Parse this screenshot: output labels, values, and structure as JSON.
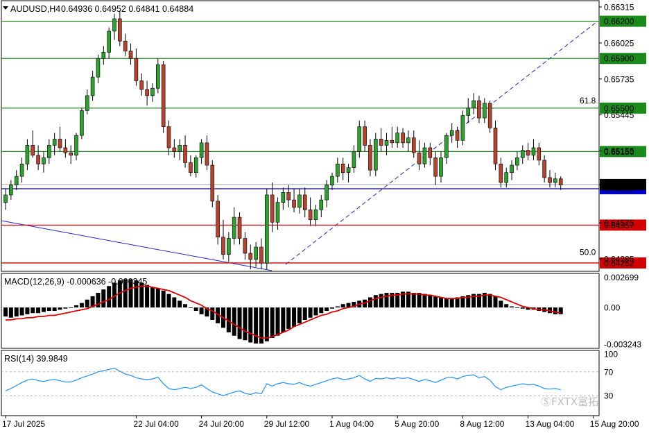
{
  "chart_data": {
    "type": "candlestick",
    "symbol_label": "AUDUSD,H4",
    "ohlc_label": "0.64936 0.64952 0.64841 0.64884",
    "price_axis": {
      "range": [
        0.6419,
        0.6636
      ],
      "ticks": [
        "0.66315",
        "0.66025",
        "0.65735",
        "0.65445",
        "0.65155",
        "0.64884",
        "0.64575",
        "0.64285"
      ]
    },
    "levels": [
      {
        "value": 0.662,
        "label": "0.66200",
        "color": "#1a8a1a",
        "style": "solid"
      },
      {
        "value": 0.659,
        "label": "0.65900",
        "color": "#1a8a1a",
        "style": "solid"
      },
      {
        "value": 0.655,
        "label": "0.65500",
        "color": "#1a8a1a",
        "style": "solid"
      },
      {
        "value": 0.6515,
        "label": "0.65150",
        "color": "#1a8a1a",
        "style": "solid"
      },
      {
        "value": 0.6485,
        "label": "0.64850",
        "color": "#0000cc",
        "style": "solid"
      },
      {
        "value": 0.64557,
        "label": "0.64557",
        "color": "#d40000",
        "style": "solid"
      },
      {
        "value": 0.64252,
        "label": "0.64252",
        "color": "#d40000",
        "style": "solid"
      }
    ],
    "current_price": {
      "value": 0.64884,
      "label": "0.64884"
    },
    "fib_labels": [
      {
        "text": "61.8",
        "value": 0.6552
      },
      {
        "text": "50.0",
        "value": 0.643
      }
    ],
    "candles": [
      [
        0.6474,
        0.6485,
        0.6468,
        0.648
      ],
      [
        0.648,
        0.6492,
        0.6476,
        0.6488
      ],
      [
        0.6488,
        0.65,
        0.6484,
        0.6495
      ],
      [
        0.6495,
        0.651,
        0.649,
        0.6505
      ],
      [
        0.6505,
        0.6525,
        0.65,
        0.652
      ],
      [
        0.652,
        0.6532,
        0.651,
        0.6512
      ],
      [
        0.6512,
        0.652,
        0.65,
        0.6505
      ],
      [
        0.6505,
        0.6515,
        0.6498,
        0.651
      ],
      [
        0.651,
        0.6525,
        0.6505,
        0.652
      ],
      [
        0.652,
        0.653,
        0.6512,
        0.6525
      ],
      [
        0.6525,
        0.6535,
        0.6515,
        0.6518
      ],
      [
        0.6518,
        0.6525,
        0.651,
        0.6514
      ],
      [
        0.6514,
        0.652,
        0.6505,
        0.6512
      ],
      [
        0.6512,
        0.653,
        0.6508,
        0.6528
      ],
      [
        0.6528,
        0.655,
        0.6525,
        0.6548
      ],
      [
        0.6548,
        0.6565,
        0.6545,
        0.656
      ],
      [
        0.656,
        0.658,
        0.6556,
        0.6575
      ],
      [
        0.6575,
        0.6593,
        0.657,
        0.659
      ],
      [
        0.659,
        0.66,
        0.6585,
        0.6595
      ],
      [
        0.6595,
        0.6615,
        0.659,
        0.6612
      ],
      [
        0.6612,
        0.6626,
        0.6605,
        0.6622
      ],
      [
        0.6622,
        0.6628,
        0.66,
        0.6604
      ],
      [
        0.6604,
        0.661,
        0.6592,
        0.6596
      ],
      [
        0.6596,
        0.6602,
        0.6585,
        0.659
      ],
      [
        0.659,
        0.6598,
        0.6568,
        0.6572
      ],
      [
        0.6572,
        0.6578,
        0.656,
        0.6565
      ],
      [
        0.6565,
        0.6572,
        0.6552,
        0.656
      ],
      [
        0.656,
        0.657,
        0.6555,
        0.6566
      ],
      [
        0.6566,
        0.659,
        0.6562,
        0.6585
      ],
      [
        0.6585,
        0.6588,
        0.653,
        0.6535
      ],
      [
        0.6535,
        0.654,
        0.6512,
        0.6518
      ],
      [
        0.6518,
        0.6525,
        0.651,
        0.6515
      ],
      [
        0.6515,
        0.6525,
        0.6508,
        0.652
      ],
      [
        0.652,
        0.6528,
        0.6502,
        0.6506
      ],
      [
        0.6506,
        0.6512,
        0.6495,
        0.6498
      ],
      [
        0.6498,
        0.6512,
        0.6494,
        0.651
      ],
      [
        0.651,
        0.6525,
        0.6505,
        0.6522
      ],
      [
        0.6522,
        0.6528,
        0.65,
        0.6504
      ],
      [
        0.6504,
        0.6508,
        0.647,
        0.6475
      ],
      [
        0.6475,
        0.648,
        0.644,
        0.6446
      ],
      [
        0.6446,
        0.646,
        0.6428,
        0.6432
      ],
      [
        0.6432,
        0.645,
        0.6426,
        0.6445
      ],
      [
        0.6445,
        0.647,
        0.644,
        0.6462
      ],
      [
        0.6462,
        0.6466,
        0.644,
        0.6445
      ],
      [
        0.6445,
        0.645,
        0.6428,
        0.6433
      ],
      [
        0.6433,
        0.644,
        0.642,
        0.6428
      ],
      [
        0.6428,
        0.6442,
        0.6422,
        0.6438
      ],
      [
        0.6438,
        0.6445,
        0.642,
        0.6425
      ],
      [
        0.6425,
        0.6485,
        0.642,
        0.648
      ],
      [
        0.648,
        0.649,
        0.645,
        0.6458
      ],
      [
        0.6458,
        0.6478,
        0.6452,
        0.6474
      ],
      [
        0.6474,
        0.6486,
        0.6468,
        0.6482
      ],
      [
        0.6482,
        0.6488,
        0.647,
        0.6476
      ],
      [
        0.6476,
        0.6485,
        0.6466,
        0.647
      ],
      [
        0.647,
        0.6485,
        0.6465,
        0.648
      ],
      [
        0.648,
        0.6486,
        0.6462,
        0.6468
      ],
      [
        0.6468,
        0.6478,
        0.6455,
        0.646
      ],
      [
        0.646,
        0.6472,
        0.6455,
        0.6468
      ],
      [
        0.6468,
        0.648,
        0.6462,
        0.6476
      ],
      [
        0.6476,
        0.6492,
        0.647,
        0.6488
      ],
      [
        0.6488,
        0.6498,
        0.6484,
        0.6495
      ],
      [
        0.6495,
        0.651,
        0.649,
        0.6505
      ],
      [
        0.6505,
        0.651,
        0.6492,
        0.6498
      ],
      [
        0.6498,
        0.6505,
        0.649,
        0.6502
      ],
      [
        0.6502,
        0.652,
        0.6498,
        0.6515
      ],
      [
        0.6515,
        0.654,
        0.651,
        0.6535
      ],
      [
        0.6535,
        0.654,
        0.6515,
        0.652
      ],
      [
        0.652,
        0.6525,
        0.6495,
        0.65
      ],
      [
        0.65,
        0.653,
        0.6495,
        0.6525
      ],
      [
        0.6525,
        0.6534,
        0.6515,
        0.652
      ],
      [
        0.652,
        0.653,
        0.6512,
        0.6524
      ],
      [
        0.6524,
        0.6535,
        0.6518,
        0.6522
      ],
      [
        0.6522,
        0.6535,
        0.6518,
        0.653
      ],
      [
        0.653,
        0.6534,
        0.6518,
        0.6522
      ],
      [
        0.6522,
        0.6532,
        0.6515,
        0.6526
      ],
      [
        0.6526,
        0.6532,
        0.651,
        0.6514
      ],
      [
        0.6514,
        0.6524,
        0.65,
        0.6505
      ],
      [
        0.6505,
        0.6522,
        0.6502,
        0.6518
      ],
      [
        0.6518,
        0.6522,
        0.6504,
        0.651
      ],
      [
        0.651,
        0.6515,
        0.6488,
        0.6495
      ],
      [
        0.6495,
        0.6515,
        0.649,
        0.651
      ],
      [
        0.651,
        0.653,
        0.6505,
        0.6528
      ],
      [
        0.6528,
        0.6538,
        0.6522,
        0.6532
      ],
      [
        0.6532,
        0.6535,
        0.6518,
        0.6524
      ],
      [
        0.6524,
        0.6548,
        0.652,
        0.6544
      ],
      [
        0.6544,
        0.6558,
        0.6538,
        0.655
      ],
      [
        0.655,
        0.6562,
        0.6545,
        0.6556
      ],
      [
        0.6556,
        0.656,
        0.6538,
        0.6542
      ],
      [
        0.6542,
        0.6558,
        0.6538,
        0.6554
      ],
      [
        0.6554,
        0.6556,
        0.653,
        0.6534
      ],
      [
        0.6534,
        0.654,
        0.65,
        0.6505
      ],
      [
        0.6505,
        0.651,
        0.6486,
        0.649
      ],
      [
        0.649,
        0.6502,
        0.6486,
        0.6498
      ],
      [
        0.6498,
        0.6508,
        0.6492,
        0.6504
      ],
      [
        0.6504,
        0.6515,
        0.65,
        0.651
      ],
      [
        0.651,
        0.652,
        0.6505,
        0.6516
      ],
      [
        0.6516,
        0.6522,
        0.6508,
        0.6512
      ],
      [
        0.6512,
        0.6525,
        0.6508,
        0.6518
      ],
      [
        0.6518,
        0.6522,
        0.6504,
        0.6508
      ],
      [
        0.6508,
        0.6512,
        0.649,
        0.6494
      ],
      [
        0.6494,
        0.65,
        0.6486,
        0.649
      ],
      [
        0.649,
        0.6498,
        0.6486,
        0.6493
      ],
      [
        0.6493,
        0.6495,
        0.6484,
        0.6488
      ]
    ],
    "macd": {
      "label": "MACD(12,26,9) -0.000636 -0.000345",
      "range": [
        -0.0035,
        0.0029
      ],
      "ticks": [
        "0.002699",
        "0.00",
        "-0.003243"
      ],
      "histogram": [
        -0.0008,
        -0.0009,
        -0.0008,
        -0.0007,
        -0.0006,
        -0.0005,
        -0.0005,
        -0.0004,
        -0.0003,
        -0.0003,
        -0.0002,
        -0.0001,
        0.0,
        0.0002,
        0.0004,
        0.0007,
        0.001,
        0.0013,
        0.0016,
        0.0019,
        0.0022,
        0.0024,
        0.0025,
        0.0025,
        0.0024,
        0.0022,
        0.002,
        0.0018,
        0.0017,
        0.0015,
        0.0012,
        0.0009,
        0.0006,
        0.0003,
        0.0,
        -0.0003,
        -0.0006,
        -0.0008,
        -0.0011,
        -0.0014,
        -0.0018,
        -0.0022,
        -0.0025,
        -0.0028,
        -0.0029,
        -0.0031,
        -0.0032,
        -0.0032,
        -0.003,
        -0.0027,
        -0.0025,
        -0.0022,
        -0.0019,
        -0.0017,
        -0.0014,
        -0.0011,
        -0.0009,
        -0.0007,
        -0.0005,
        -0.0003,
        -0.0001,
        0.0001,
        0.0003,
        0.0004,
        0.0005,
        0.0006,
        0.0007,
        0.0009,
        0.0011,
        0.0012,
        0.0013,
        0.0013,
        0.0013,
        0.0014,
        0.0014,
        0.0013,
        0.0013,
        0.0012,
        0.0011,
        0.001,
        0.0009,
        0.0008,
        0.0008,
        0.0009,
        0.001,
        0.0011,
        0.0012,
        0.0012,
        0.0013,
        0.0012,
        0.001,
        0.0006,
        0.0003,
        0.0001,
        0.0,
        -0.0001,
        -0.0002,
        -0.0002,
        -0.0003,
        -0.0004,
        -0.0005,
        -0.0006,
        -0.0006
      ],
      "signal": [
        -0.0011,
        -0.0011,
        -0.001,
        -0.001,
        -0.0009,
        -0.0009,
        -0.0008,
        -0.0008,
        -0.0007,
        -0.0007,
        -0.0006,
        -0.0005,
        -0.0004,
        -0.0003,
        -0.0002,
        -0.0001,
        0.0001,
        0.0003,
        0.0005,
        0.0007,
        0.001,
        0.0013,
        0.0015,
        0.0017,
        0.0018,
        0.0019,
        0.0019,
        0.0018,
        0.0017,
        0.0016,
        0.0015,
        0.0013,
        0.0011,
        0.0009,
        0.0006,
        0.0004,
        0.0002,
        -0.0001,
        -0.0003,
        -0.0006,
        -0.0009,
        -0.0012,
        -0.0015,
        -0.0018,
        -0.0021,
        -0.0023,
        -0.0025,
        -0.0027,
        -0.0027,
        -0.0026,
        -0.0024,
        -0.0022,
        -0.002,
        -0.0017,
        -0.0015,
        -0.0013,
        -0.0011,
        -0.0009,
        -0.0007,
        -0.0006,
        -0.0004,
        -0.0003,
        -0.0001,
        0.0,
        0.0001,
        0.0003,
        0.0004,
        0.0006,
        0.0008,
        0.0009,
        0.001,
        0.0011,
        0.0011,
        0.0012,
        0.0012,
        0.0012,
        0.0012,
        0.0011,
        0.0011,
        0.001,
        0.0009,
        0.0008,
        0.0008,
        0.0008,
        0.0009,
        0.0009,
        0.001,
        0.001,
        0.0011,
        0.0011,
        0.001,
        0.0009,
        0.0007,
        0.0005,
        0.0003,
        0.0001,
        0.0,
        -0.0001,
        -0.0002,
        -0.0002,
        -0.0003,
        -0.0004,
        -0.0005
      ]
    },
    "rsi": {
      "label": "RSI(14) 39.9849",
      "range": [
        0,
        100
      ],
      "ticks": [
        "100",
        "70",
        "30"
      ],
      "levels": [
        70,
        30
      ],
      "values": [
        38,
        42,
        47,
        52,
        56,
        58,
        55,
        54,
        56,
        57,
        55,
        53,
        53,
        56,
        60,
        63,
        66,
        70,
        72,
        74,
        76,
        71,
        66,
        64,
        60,
        58,
        57,
        58,
        61,
        50,
        42,
        40,
        42,
        44,
        42,
        44,
        48,
        42,
        36,
        33,
        30,
        33,
        36,
        38,
        34,
        32,
        35,
        33,
        50,
        46,
        50,
        52,
        50,
        49,
        52,
        48,
        46,
        49,
        52,
        55,
        58,
        60,
        57,
        58,
        60,
        64,
        58,
        54,
        59,
        58,
        60,
        58,
        60,
        59,
        60,
        57,
        54,
        57,
        55,
        52,
        56,
        60,
        61,
        58,
        62,
        64,
        65,
        60,
        62,
        56,
        45,
        40,
        44,
        46,
        48,
        50,
        48,
        49,
        46,
        42,
        41,
        42,
        40
      ]
    },
    "x_axis": {
      "labels": [
        {
          "text": "17 Jul 2025",
          "index": 0
        },
        {
          "text": "22 Jul 04:00",
          "index": 24
        },
        {
          "text": "24 Jul 20:00",
          "index": 36
        },
        {
          "text": "29 Jul 12:00",
          "index": 48
        },
        {
          "text": "1 Aug 04:00",
          "index": 60
        },
        {
          "text": "5 Aug 20:00",
          "index": 72
        },
        {
          "text": "8 Aug 12:00",
          "index": 84
        },
        {
          "text": "13 Aug 04:00",
          "index": 96
        },
        {
          "text": "15 Aug 20:00",
          "index": 108
        }
      ]
    },
    "watermark": "ⓈFXTX富拓",
    "colors": {
      "bull": "#2ea02e",
      "bear": "#b5432d",
      "signal": "#e00000",
      "rsi": "#1e90ff",
      "trend": "#2222cc"
    }
  }
}
